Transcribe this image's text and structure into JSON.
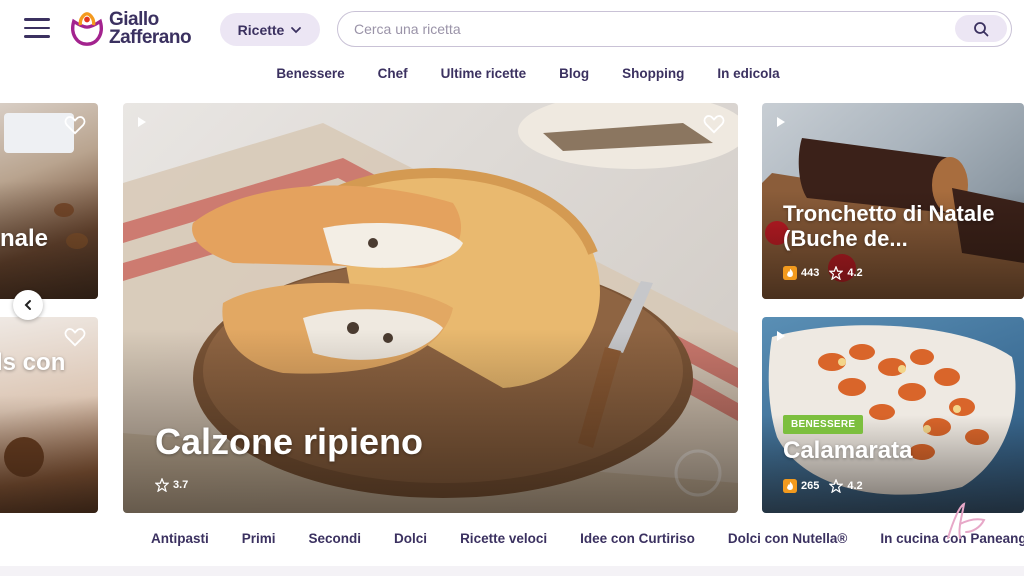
{
  "brand": {
    "line1": "Giallo",
    "line2": "Zafferano"
  },
  "header": {
    "ricette_label": "Ricette",
    "search_placeholder": "Cerca una ricetta",
    "search_value": ""
  },
  "topnav": [
    "Benessere",
    "Chef",
    "Ultime ricette",
    "Blog",
    "Shopping",
    "In edicola"
  ],
  "cards": {
    "left_top": {
      "title": "nale"
    },
    "left_bottom": {
      "title": "ls con"
    },
    "main": {
      "title": "Calzone ripieno",
      "rating": "3.7"
    },
    "right_top": {
      "title": "Tronchetto di Natale (Buche de...",
      "heat": "443",
      "rating": "4.2"
    },
    "right_bottom": {
      "badge": "BENESSERE",
      "title": "Calamarata",
      "heat": "265",
      "rating": "4.2"
    }
  },
  "categories": [
    "Antipasti",
    "Primi",
    "Secondi",
    "Dolci",
    "Ricette veloci",
    "Idee con Curtiriso",
    "Dolci con Nutella®",
    "In cucina con Paneangeli"
  ],
  "colors": {
    "brand_purple": "#3b3160",
    "pill_bg": "#ece6f4",
    "badge_green": "#7cbf3e",
    "flame_orange": "#f29a1e"
  }
}
